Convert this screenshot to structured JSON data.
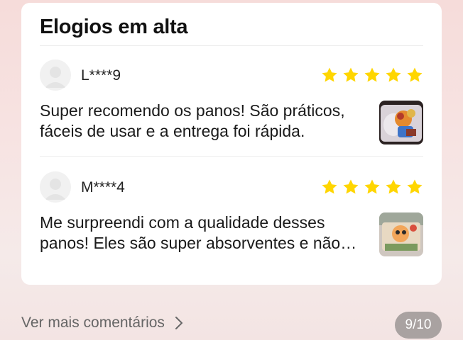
{
  "section": {
    "title": "Elogios em alta"
  },
  "reviews": [
    {
      "username": "L****9",
      "rating": 5,
      "text": "Super recomendo os panos! São práticos, fáceis de usar e a entrega foi rápida.",
      "thumbnail_icon": "product-photo"
    },
    {
      "username": "M****4",
      "rating": 5,
      "text": "Me surpreendi com a qualidade desses panos! Eles são super absorventes e não soltam fiapos.",
      "thumbnail_icon": "product-photo"
    }
  ],
  "footer": {
    "more_label": "Ver mais comentários",
    "more_icon": "chevron-right-icon",
    "page_indicator": "9/10"
  },
  "colors": {
    "star": "#ffd600",
    "card": "#ffffff",
    "badge": "#a9a2a1"
  }
}
